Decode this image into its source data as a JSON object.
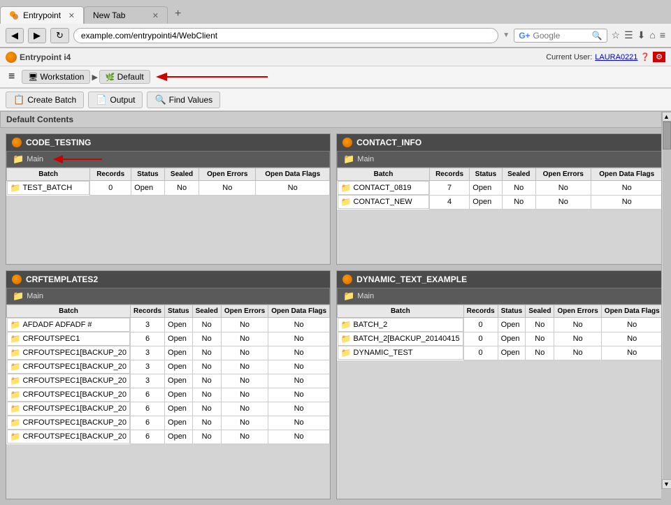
{
  "browser": {
    "tabs": [
      {
        "label": "Entrypoint",
        "active": true
      },
      {
        "label": "New Tab",
        "active": false
      }
    ],
    "url": "example.com/entrypointi4/WebClient",
    "search_placeholder": "Google"
  },
  "app": {
    "title": "Entrypoint i4",
    "current_user_label": "Current User:",
    "current_user": "LAURA0221",
    "hamburger": "≡",
    "nav": {
      "workstation": "Workstation",
      "default": "Default"
    },
    "actions": {
      "create_batch": "Create Batch",
      "output": "Output",
      "find_values": "Find Values"
    },
    "section_title": "Default Contents"
  },
  "panels": [
    {
      "id": "code_testing",
      "title": "CODE_TESTING",
      "folder": "Main",
      "columns": [
        "Batch",
        "Records",
        "Status",
        "Sealed",
        "Open Errors",
        "Open Data Flags"
      ],
      "rows": [
        {
          "batch": "TEST_BATCH",
          "records": "0",
          "status": "Open",
          "sealed": "No",
          "open_errors": "No",
          "open_flags": "No"
        }
      ]
    },
    {
      "id": "contact_info",
      "title": "CONTACT_INFO",
      "folder": "Main",
      "columns": [
        "Batch",
        "Records",
        "Status",
        "Sealed",
        "Open Errors",
        "Open Data Flags"
      ],
      "rows": [
        {
          "batch": "CONTACT_0819",
          "records": "7",
          "status": "Open",
          "sealed": "No",
          "open_errors": "No",
          "open_flags": "No"
        },
        {
          "batch": "CONTACT_NEW",
          "records": "4",
          "status": "Open",
          "sealed": "No",
          "open_errors": "No",
          "open_flags": "No"
        }
      ]
    },
    {
      "id": "crftemplates2",
      "title": "CRFTEMPLATES2",
      "folder": "Main",
      "columns": [
        "Batch",
        "Records",
        "Status",
        "Sealed",
        "Open Errors",
        "Open Data Flags"
      ],
      "rows": [
        {
          "batch": "AFDADF ADFADF #",
          "records": "3",
          "status": "Open",
          "sealed": "No",
          "open_errors": "No",
          "open_flags": "No"
        },
        {
          "batch": "CRFOUTSPEC1",
          "records": "6",
          "status": "Open",
          "sealed": "No",
          "open_errors": "No",
          "open_flags": "No"
        },
        {
          "batch": "CRFOUTSPEC1[BACKUP_20",
          "records": "3",
          "status": "Open",
          "sealed": "No",
          "open_errors": "No",
          "open_flags": "No"
        },
        {
          "batch": "CRFOUTSPEC1[BACKUP_20",
          "records": "3",
          "status": "Open",
          "sealed": "No",
          "open_errors": "No",
          "open_flags": "No"
        },
        {
          "batch": "CRFOUTSPEC1[BACKUP_20",
          "records": "3",
          "status": "Open",
          "sealed": "No",
          "open_errors": "No",
          "open_flags": "No"
        },
        {
          "batch": "CRFOUTSPEC1[BACKUP_20",
          "records": "6",
          "status": "Open",
          "sealed": "No",
          "open_errors": "No",
          "open_flags": "No"
        },
        {
          "batch": "CRFOUTSPEC1[BACKUP_20",
          "records": "6",
          "status": "Open",
          "sealed": "No",
          "open_errors": "No",
          "open_flags": "No"
        },
        {
          "batch": "CRFOUTSPEC1[BACKUP_20",
          "records": "6",
          "status": "Open",
          "sealed": "No",
          "open_errors": "No",
          "open_flags": "No"
        },
        {
          "batch": "CRFOUTSPEC1[BACKUP_20",
          "records": "6",
          "status": "Open",
          "sealed": "No",
          "open_errors": "No",
          "open_flags": "No"
        }
      ]
    },
    {
      "id": "dynamic_text",
      "title": "DYNAMIC_TEXT_EXAMPLE",
      "folder": "Main",
      "columns": [
        "Batch",
        "Records",
        "Status",
        "Sealed",
        "Open Errors",
        "Open Data Flags"
      ],
      "rows": [
        {
          "batch": "BATCH_2",
          "records": "0",
          "status": "Open",
          "sealed": "No",
          "open_errors": "No",
          "open_flags": "No"
        },
        {
          "batch": "BATCH_2[BACKUP_20140415",
          "records": "0",
          "status": "Open",
          "sealed": "No",
          "open_errors": "No",
          "open_flags": "No"
        },
        {
          "batch": "DYNAMIC_TEST",
          "records": "0",
          "status": "Open",
          "sealed": "No",
          "open_errors": "No",
          "open_flags": "No"
        }
      ]
    }
  ]
}
